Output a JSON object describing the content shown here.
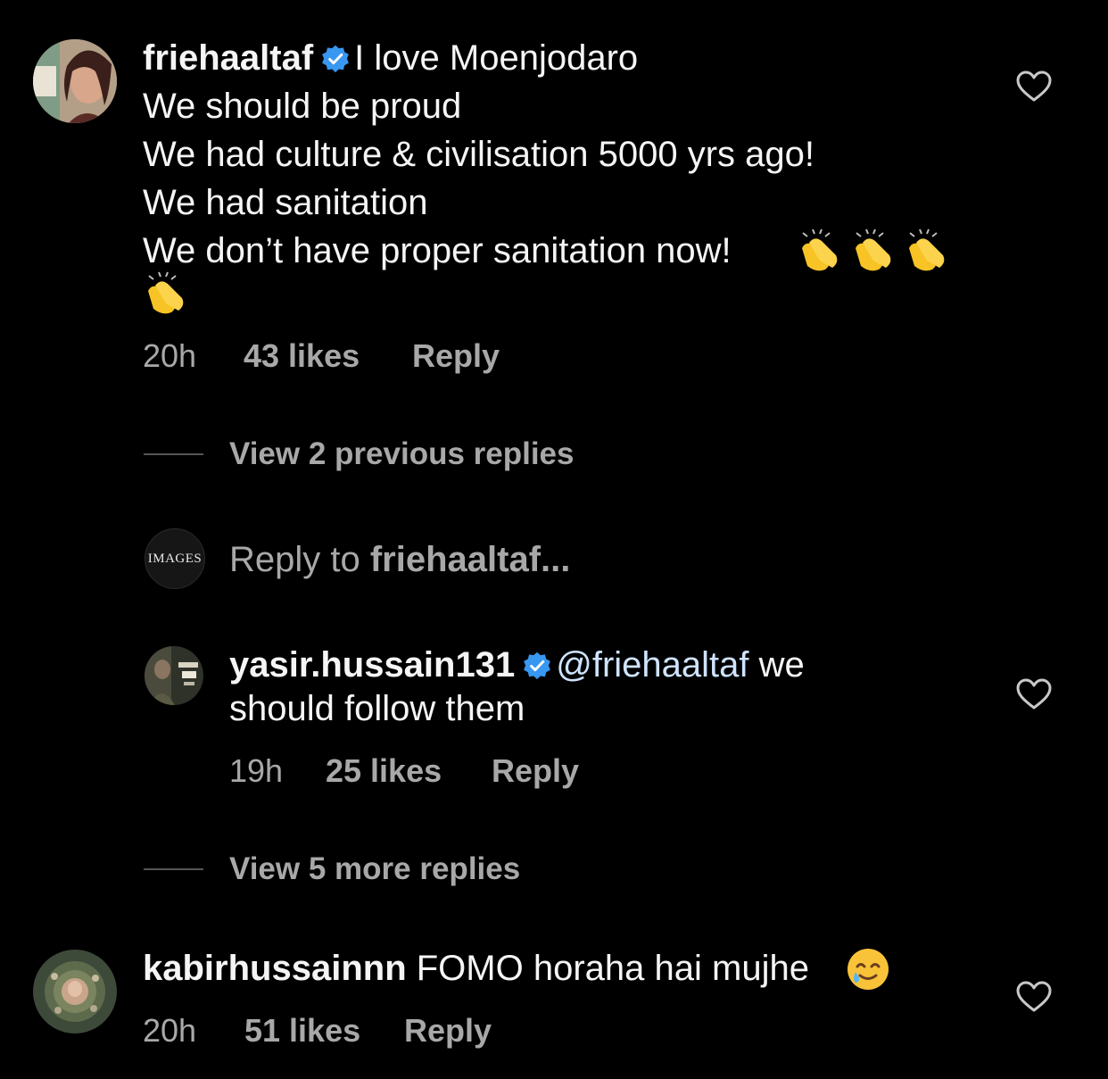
{
  "comments": [
    {
      "username": "friehaaltaf",
      "verified": true,
      "text_lines": [
        "I love Moenjodaro",
        "We should be proud",
        "We had culture & civilisation 5000 yrs ago!",
        "We had sanitation",
        "We don’t have proper sanitation now!"
      ],
      "emojis": "👏👏👏👏",
      "time": "20h",
      "likes": "43 likes",
      "reply_label": "Reply",
      "avatar_icon": "avatar-photo-icon"
    },
    {
      "username": "kabirhussainnn",
      "verified": false,
      "text": "FOMO horaha hai mujhe",
      "emoji": "🥲",
      "time": "20h",
      "likes": "51 likes",
      "reply_label": "Reply",
      "avatar_icon": "avatar-photo-icon"
    }
  ],
  "thread": {
    "view_previous": "View 2 previous replies",
    "reply_to": {
      "avatar_text": "IMAGES",
      "prefix": "Reply to ",
      "username": "friehaaltaf..."
    },
    "reply": {
      "username": "yasir.hussain131",
      "verified": true,
      "mention": "@friehaaltaf",
      "text_line1_suffix": " we",
      "text_line2": "should follow them",
      "time": "19h",
      "likes": "25 likes",
      "reply_label": "Reply"
    },
    "view_more": "View 5 more replies"
  },
  "colors": {
    "background": "#000000",
    "text_primary": "#f5f5f5",
    "text_secondary": "#a8a8a8",
    "verified_blue": "#3897f0",
    "divider": "#555555"
  }
}
